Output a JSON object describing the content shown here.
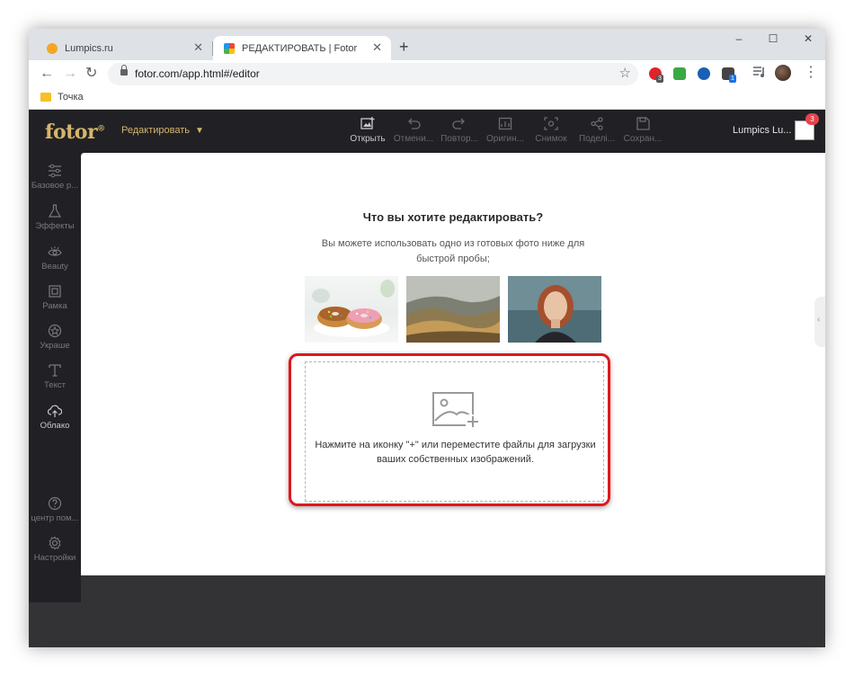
{
  "browser": {
    "tabs": [
      {
        "title": "Lumpics.ru",
        "active": false,
        "favicon_color": "#f5a623"
      },
      {
        "title": "РЕДАКТИРОВАТЬ | Fotor",
        "active": true
      }
    ],
    "tab_close": "✕",
    "new_tab": "+",
    "window_controls": {
      "minimize": "–",
      "maximize": "☐",
      "close": "✕"
    },
    "nav": {
      "back": "←",
      "forward": "→",
      "reload": "↻"
    },
    "url": "fotor.com/app.html#/editor",
    "bookmark_star": "☆",
    "extensions": [
      {
        "name": "opera-icon",
        "color": "#e0242b",
        "badge": "3",
        "badge_color": "#555555"
      },
      {
        "name": "music-icon",
        "color": "#3aa845"
      },
      {
        "name": "vpn-globe-icon",
        "color": "#1a5fb4"
      },
      {
        "name": "puzzle-icon",
        "color": "#444444",
        "badge": "1",
        "badge_color": "#1a73e8"
      }
    ],
    "menu": "⋮",
    "bookmarks": [
      {
        "label": "Точка"
      }
    ]
  },
  "app": {
    "logo": "fotor",
    "logo_mark": "®",
    "edit_menu": "Редактировать",
    "tools": [
      {
        "label": "Открыть",
        "icon": "open-image-icon",
        "enabled": true
      },
      {
        "label": "Отмени...",
        "icon": "undo-icon",
        "enabled": false
      },
      {
        "label": "Повтор...",
        "icon": "redo-icon",
        "enabled": false
      },
      {
        "label": "Оригин...",
        "icon": "original-icon",
        "enabled": false
      },
      {
        "label": "Снимок",
        "icon": "snapshot-icon",
        "enabled": false
      },
      {
        "label": "Поделі...",
        "icon": "share-icon",
        "enabled": false
      },
      {
        "label": "Сохран...",
        "icon": "save-icon",
        "enabled": false
      }
    ],
    "username": "Lumpics Lu...",
    "notification_count": "3",
    "accent_color": "#d6b56b",
    "sidebar": [
      {
        "label": "Базовое р...",
        "icon": "sliders-icon"
      },
      {
        "label": "Эффекты",
        "icon": "flask-icon"
      },
      {
        "label": "Beauty",
        "icon": "eye-icon"
      },
      {
        "label": "Рамка",
        "icon": "frame-icon"
      },
      {
        "label": "Украше",
        "icon": "star-badge-icon"
      },
      {
        "label": "Текст",
        "icon": "text-icon"
      },
      {
        "label": "Облако",
        "icon": "cloud-upload-icon"
      }
    ],
    "sidebar_bottom": [
      {
        "label": "центр пом...",
        "icon": "help-icon"
      },
      {
        "label": "Настройки",
        "icon": "settings-icon"
      }
    ],
    "main": {
      "heading": "Что вы хотите редактировать?",
      "subtext": "Вы можете использовать одно из готовых фото ниже для быстрой пробы;",
      "samples": [
        {
          "name": "donuts"
        },
        {
          "name": "hills-landscape"
        },
        {
          "name": "portrait"
        }
      ],
      "dropzone_text": "Нажмите на иконку \"+\" или переместите файлы для загрузки ваших собственных изображений.",
      "highlight_color": "#e0171b"
    },
    "collapse_arrow": "‹"
  }
}
